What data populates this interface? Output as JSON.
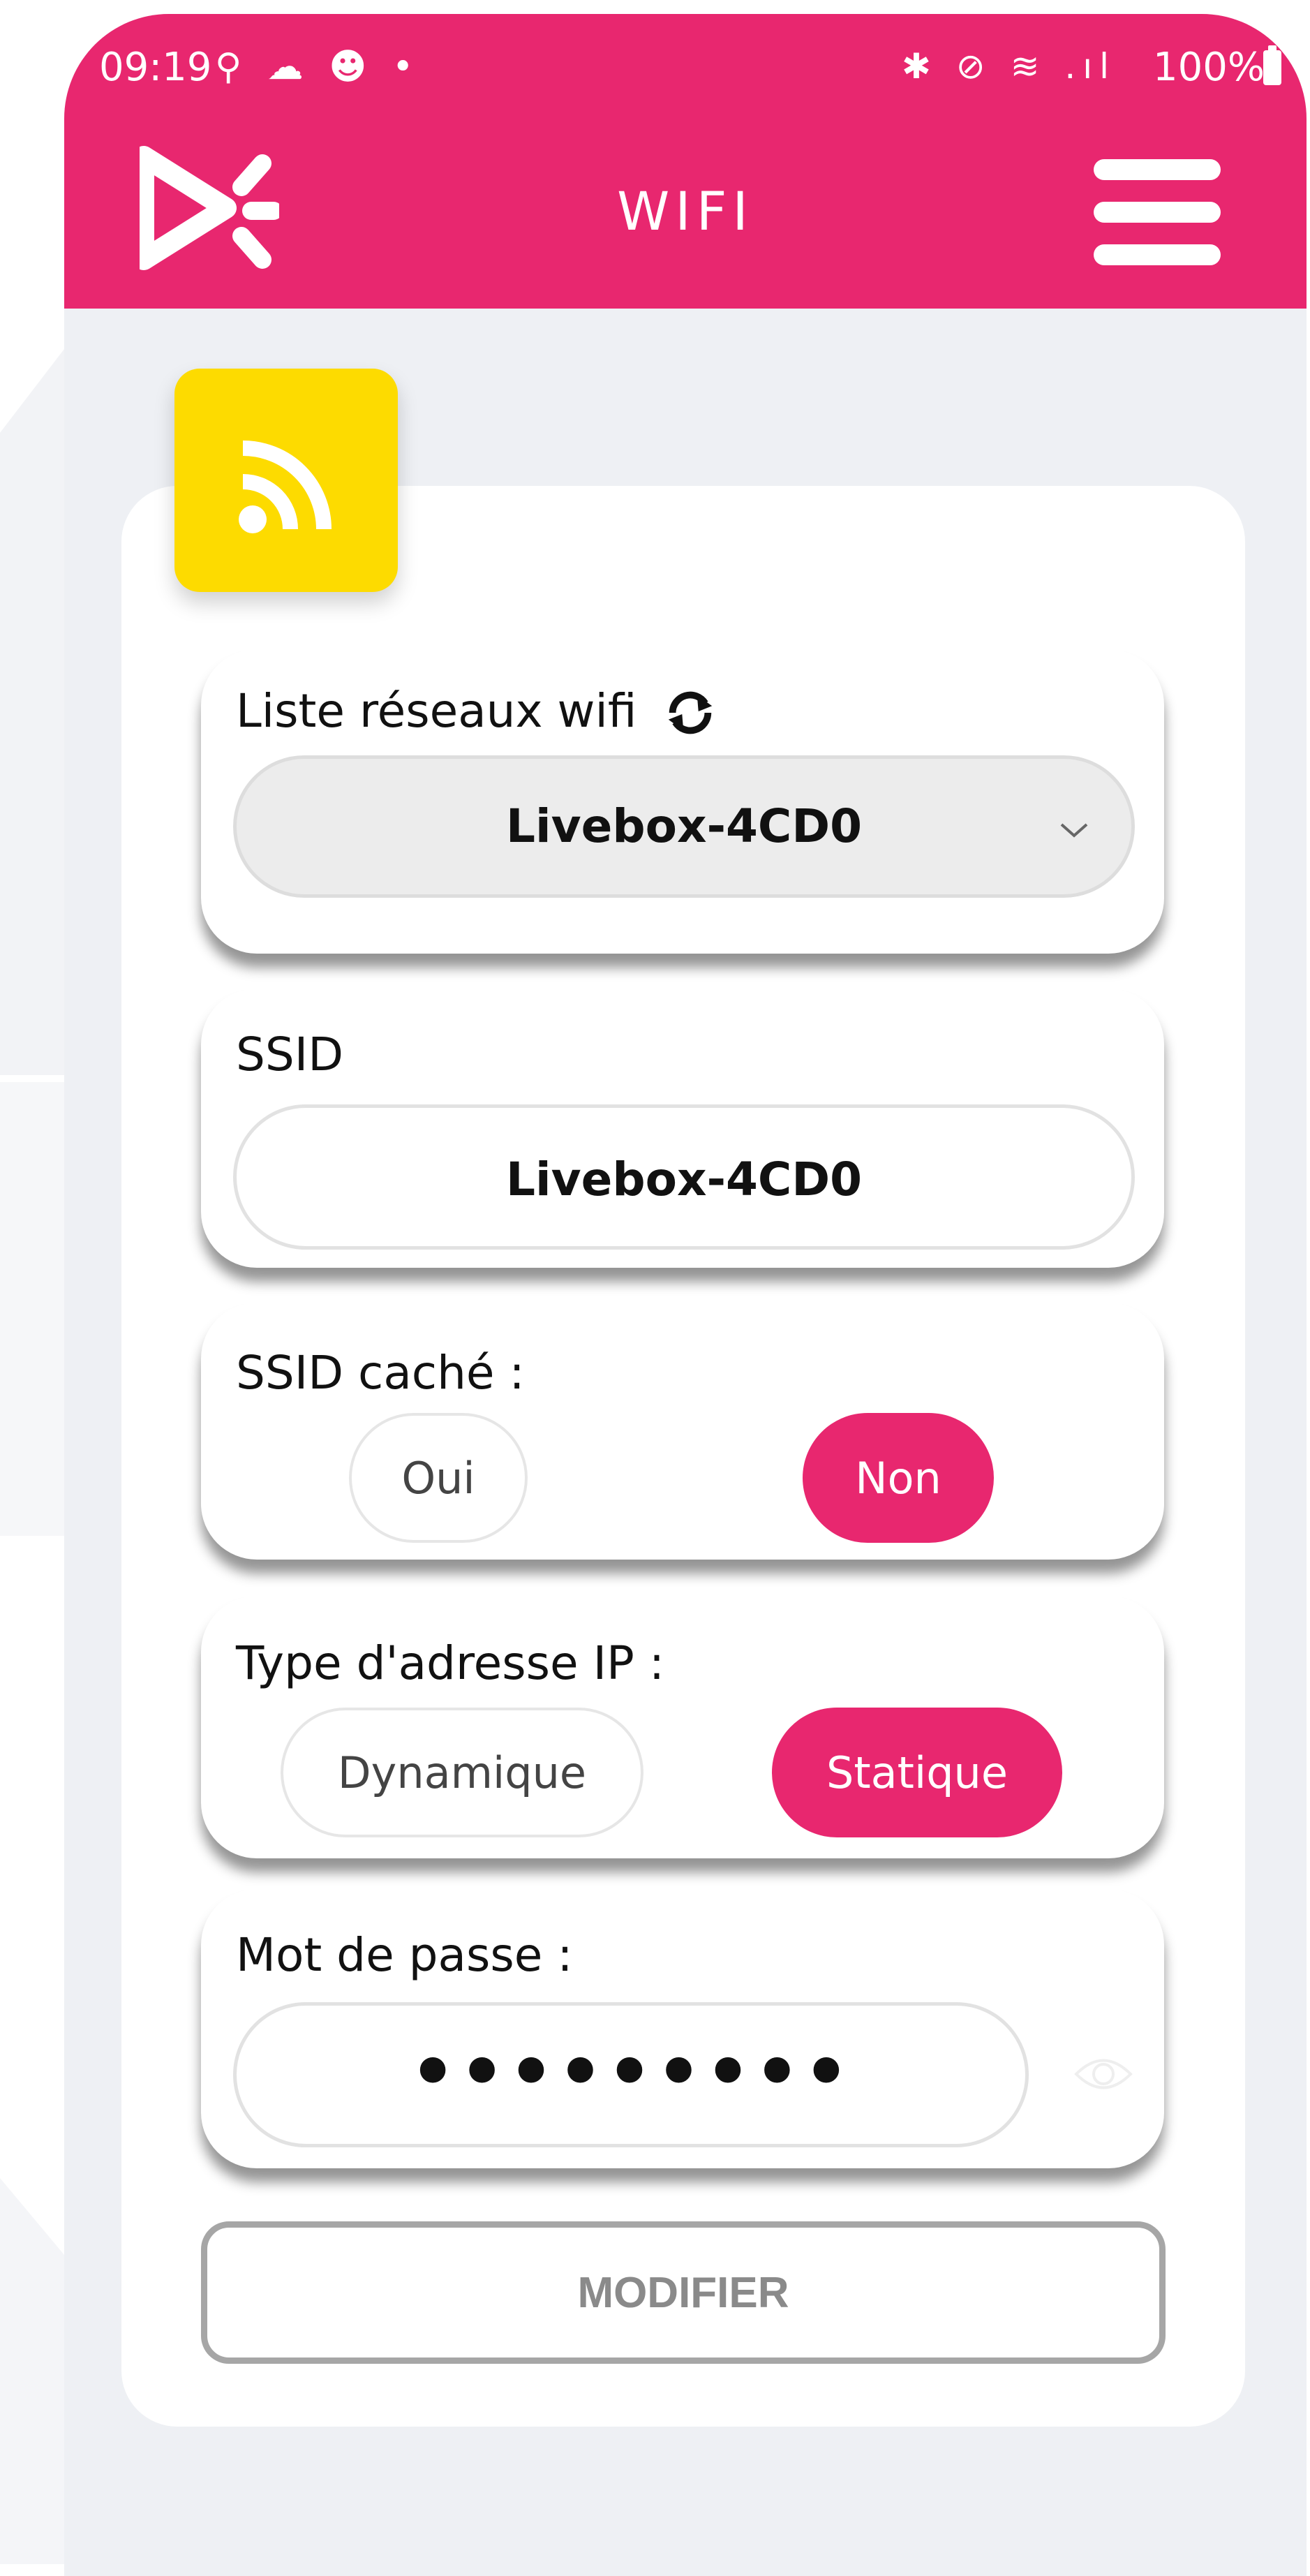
{
  "status_bar": {
    "time": "09:19",
    "left_icons": "⚲ ☁ ☻ •",
    "right_icons": "✱ ⊘ ≋ .ıl",
    "battery": "100%"
  },
  "header": {
    "title": "WIFI",
    "logo_icon": "brand-logo-icon",
    "menu_icon": "hamburger-menu-icon"
  },
  "wifi_badge": {
    "icon": "wifi-signal-icon",
    "color": "#fddb00"
  },
  "networks": {
    "label": "Liste réseaux wifi",
    "refresh_icon": "refresh-icon",
    "selected": "Livebox-4CD0"
  },
  "ssid": {
    "label": "SSID",
    "value": "Livebox-4CD0"
  },
  "hidden_ssid": {
    "label": "SSID caché :",
    "options": [
      "Oui",
      "Non"
    ],
    "selected": "Non"
  },
  "ip_type": {
    "label": "Type d'adresse IP :",
    "options": [
      "Dynamique",
      "Statique"
    ],
    "selected": "Statique"
  },
  "password": {
    "label": "Mot de passe :",
    "value": "•••••••••",
    "toggle_icon": "eye-icon"
  },
  "submit_label": "MODIFIER",
  "colors": {
    "accent": "#e8276f",
    "badge": "#fddb00",
    "background": "#eef0f4"
  }
}
